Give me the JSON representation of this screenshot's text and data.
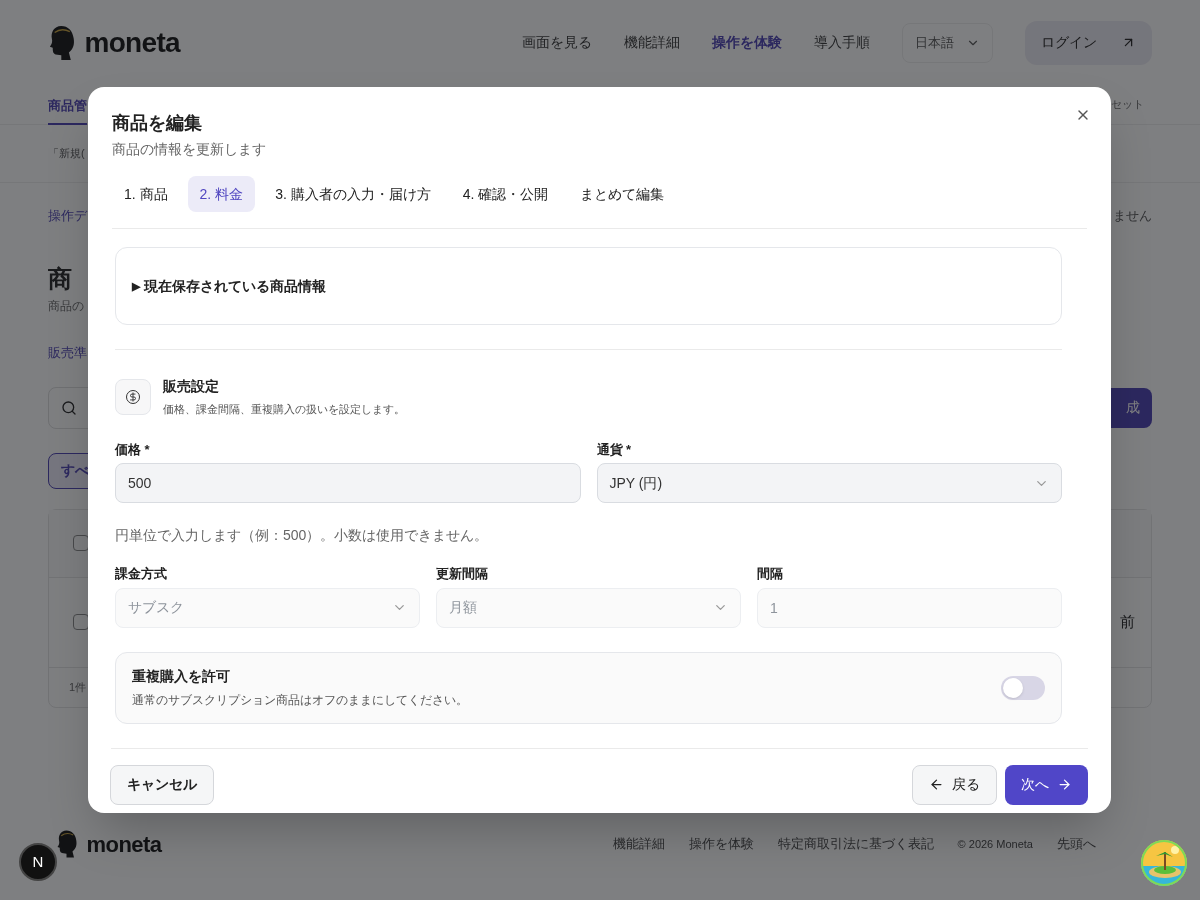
{
  "header": {
    "logo": "moneta",
    "nav": [
      {
        "label": "画面を見る",
        "selected": false
      },
      {
        "label": "機能詳細",
        "selected": false
      },
      {
        "label": "操作を体験",
        "selected": true
      },
      {
        "label": "導入手順",
        "selected": false
      }
    ],
    "language": "日本語",
    "login": "ログイン"
  },
  "page": {
    "tab": "商品管",
    "tab_right": "セット",
    "notice": "「新規(",
    "breadcrumb": "操作デ",
    "breadcrumb_right": "ません",
    "heading": "商",
    "subheading": "商品の",
    "link": "販売準",
    "create_button": "成",
    "filter": "すべ",
    "checkboxes": [
      {
        "checked": false
      },
      {
        "checked": false
      }
    ],
    "row_cell": "前",
    "table_footer": "1件"
  },
  "dialog": {
    "title": "商品を編集",
    "subtitle": "商品の情報を更新します",
    "tabs": [
      {
        "label": "1. 商品",
        "selected": false
      },
      {
        "label": "2. 料金",
        "selected": true
      },
      {
        "label": "3. 購入者の入力・届け方",
        "selected": false
      },
      {
        "label": "4. 確認・公開",
        "selected": false
      },
      {
        "label": "まとめて編集",
        "selected": false
      }
    ],
    "saved_info": {
      "marker": "▶",
      "label": "現在保存されている商品情報"
    },
    "section": {
      "title": "販売設定",
      "description": "価格、課金間隔、重複購入の扱いを設定します。"
    },
    "price_fields": [
      {
        "kind": "input",
        "label": "価格 *",
        "value": "500"
      },
      {
        "kind": "select",
        "label": "通貨 *",
        "value": "JPY (円)"
      }
    ],
    "hint": "円単位で入力します（例：500）。小数は使用できません。",
    "plan_fields": [
      {
        "kind": "select",
        "label": "課金方式",
        "value": "サブスク",
        "disabled": true
      },
      {
        "kind": "select",
        "label": "更新間隔",
        "value": "月額",
        "disabled": true
      },
      {
        "kind": "input",
        "label": "間隔",
        "value": "1",
        "disabled": true
      }
    ],
    "duplicate": {
      "title": "重複購入を許可",
      "description": "通常のサブスクリプション商品はオフのままにしてください。",
      "on": false
    },
    "cancel": "キャンセル",
    "back": "戻る",
    "next": "次へ"
  },
  "footer": {
    "logo": "moneta",
    "links": [
      "機能詳細",
      "操作を体験",
      "特定商取引法に基づく表記"
    ],
    "copyright": "© 2026 Moneta",
    "top": "先頭へ",
    "badge": "N"
  }
}
